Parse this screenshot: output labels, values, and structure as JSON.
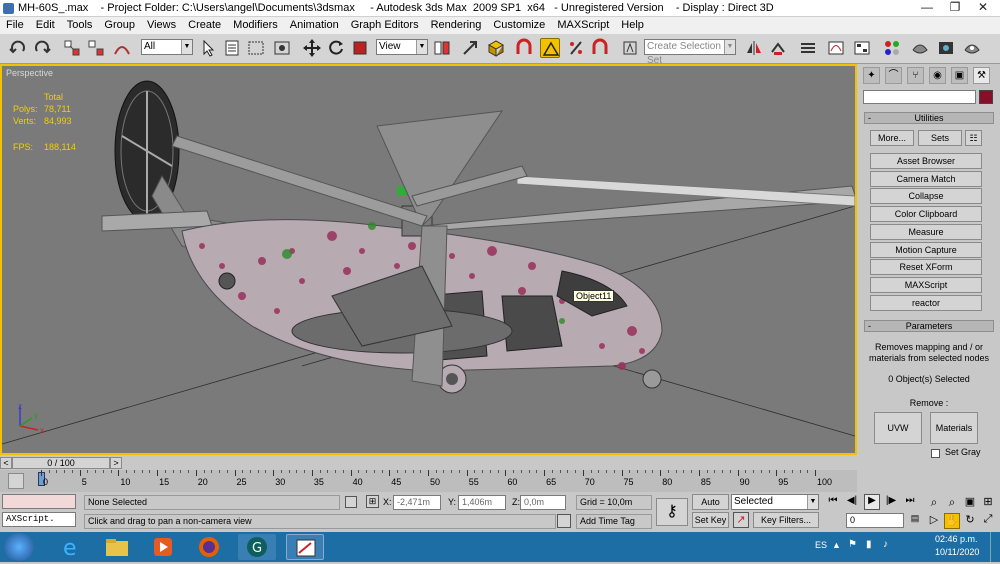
{
  "titlebar": {
    "title": "MH-60S_.max    - Project Folder: C:\\Users\\angel\\Documents\\3dsmax     - Autodesk 3ds Max  2009 SP1  x64   - Unregistered Version    - Display : Direct 3D",
    "minimize": "—",
    "restore": "❐",
    "close": "✕"
  },
  "menu": [
    "File",
    "Edit",
    "Tools",
    "Group",
    "Views",
    "Create",
    "Modifiers",
    "Animation",
    "Graph Editors",
    "Rendering",
    "Customize",
    "MAXScript",
    "Help"
  ],
  "toolbar": {
    "selection_filter": "All",
    "ref_coord": "View",
    "named_selection_placeholder": "Create Selection Set"
  },
  "viewport": {
    "label": "Perspective",
    "stats_total": "Total",
    "polys_label": "Polys:",
    "polys_value": "78,711",
    "verts_label": "Verts:",
    "verts_value": "84,993",
    "fps_label": "FPS:",
    "fps_value": "188,114",
    "tooltip": "Object11",
    "axis_x": "x",
    "axis_y": "y",
    "axis_z": "z"
  },
  "command_panel": {
    "tabs": [
      "create-icon",
      "modify-icon",
      "hierarchy-icon",
      "motion-icon",
      "display-icon",
      "utilities-icon"
    ],
    "utilities_header": "Utilities",
    "more_btn": "More...",
    "sets_btn": "Sets",
    "utilities": [
      "Asset Browser",
      "Camera Match",
      "Collapse",
      "Color Clipboard",
      "Measure",
      "Motion Capture",
      "Reset XForm",
      "MAXScript",
      "reactor"
    ],
    "params_header": "Parameters",
    "params_desc": "Removes mapping and / or materials from selected nodes",
    "selected_count": "0 Object(s) Selected",
    "remove_label": "Remove :",
    "uvw_btn": "UVW",
    "materials_btn": "Materials",
    "set_gray": "Set Gray",
    "minus": "-"
  },
  "timeslider": {
    "value": "0 / 100",
    "prev": "<",
    "next": ">"
  },
  "track_ticks": [
    "0",
    "5",
    "10",
    "15",
    "20",
    "25",
    "30",
    "35",
    "40",
    "45",
    "50",
    "55",
    "60",
    "65",
    "70",
    "75",
    "80",
    "85",
    "90",
    "95",
    "100"
  ],
  "status": {
    "maxscript_label": "AXScript.",
    "selection": "None Selected",
    "prompt": "Click and drag to pan a non-camera view",
    "x_label": "X:",
    "x_value": "-2,471m",
    "y_label": "Y:",
    "y_value": "1,406m",
    "z_label": "Z:",
    "z_value": "0,0m",
    "grid": "Grid = 10,0m",
    "add_time_tag": "Add Time Tag",
    "auto_key": "Auto Key",
    "set_key": "Set Key",
    "key_mode": "Selected",
    "key_filters": "Key Filters...",
    "frame": "0"
  },
  "taskbar": {
    "lang": "ES",
    "time": "02:46 p.m.",
    "date": "10/11/2020"
  }
}
